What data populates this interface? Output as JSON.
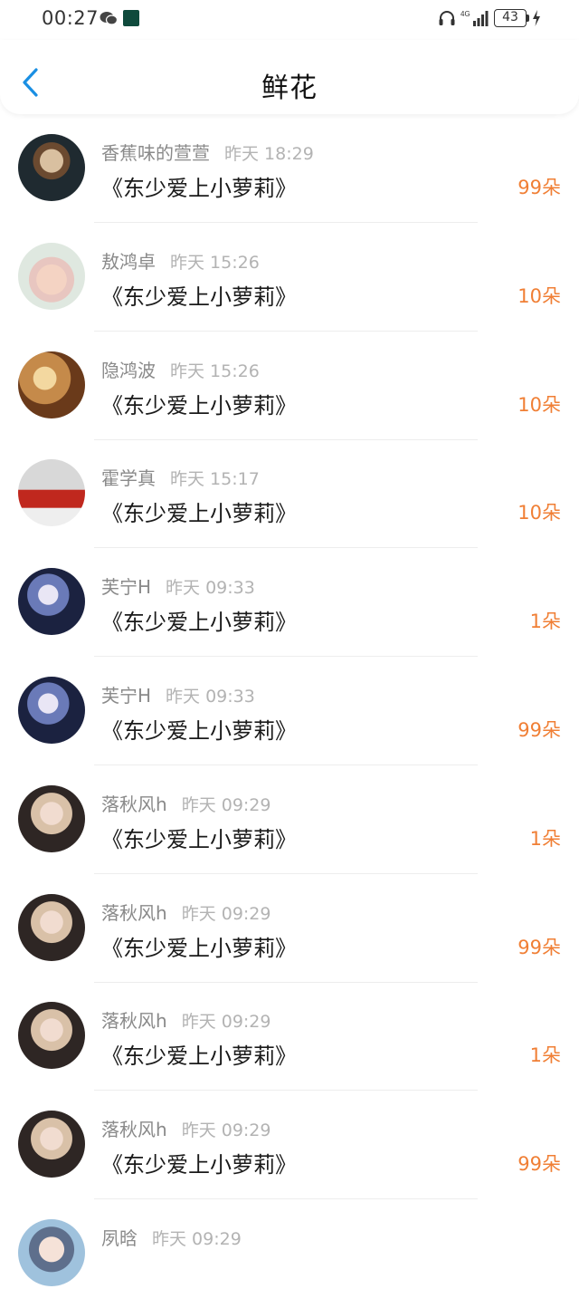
{
  "status_bar": {
    "time": "00:27",
    "battery": "43",
    "network": "4G",
    "icons": [
      "wechat-icon",
      "app-icon",
      "headphone-icon",
      "signal-icon",
      "battery-icon",
      "charging-icon"
    ]
  },
  "header": {
    "title": "鲜花",
    "back_icon": "chevron-left-icon",
    "accent_color": "#1a8fe3"
  },
  "colors": {
    "count": "#f07f35",
    "name": "#8a8a8a",
    "time": "#b3b3b3"
  },
  "gifts": [
    {
      "user": "香蕉味的萱萱",
      "time": "昨天 18:29",
      "work": "《东少爱上小萝莉》",
      "count": "99朵"
    },
    {
      "user": "敖鸿卓",
      "time": "昨天 15:26",
      "work": "《东少爱上小萝莉》",
      "count": "10朵"
    },
    {
      "user": "隐鸿波",
      "time": "昨天 15:26",
      "work": "《东少爱上小萝莉》",
      "count": "10朵"
    },
    {
      "user": "霍学真",
      "time": "昨天 15:17",
      "work": "《东少爱上小萝莉》",
      "count": "10朵"
    },
    {
      "user": "芙宁H",
      "time": "昨天 09:33",
      "work": "《东少爱上小萝莉》",
      "count": "1朵"
    },
    {
      "user": "芙宁H",
      "time": "昨天 09:33",
      "work": "《东少爱上小萝莉》",
      "count": "99朵"
    },
    {
      "user": "落秋风h",
      "time": "昨天 09:29",
      "work": "《东少爱上小萝莉》",
      "count": "1朵"
    },
    {
      "user": "落秋风h",
      "time": "昨天 09:29",
      "work": "《东少爱上小萝莉》",
      "count": "99朵"
    },
    {
      "user": "落秋风h",
      "time": "昨天 09:29",
      "work": "《东少爱上小萝莉》",
      "count": "1朵"
    },
    {
      "user": "落秋风h",
      "time": "昨天 09:29",
      "work": "《东少爱上小萝莉》",
      "count": "99朵"
    },
    {
      "user": "夙晗",
      "time": "昨天 09:29",
      "work": "",
      "count": ""
    }
  ]
}
